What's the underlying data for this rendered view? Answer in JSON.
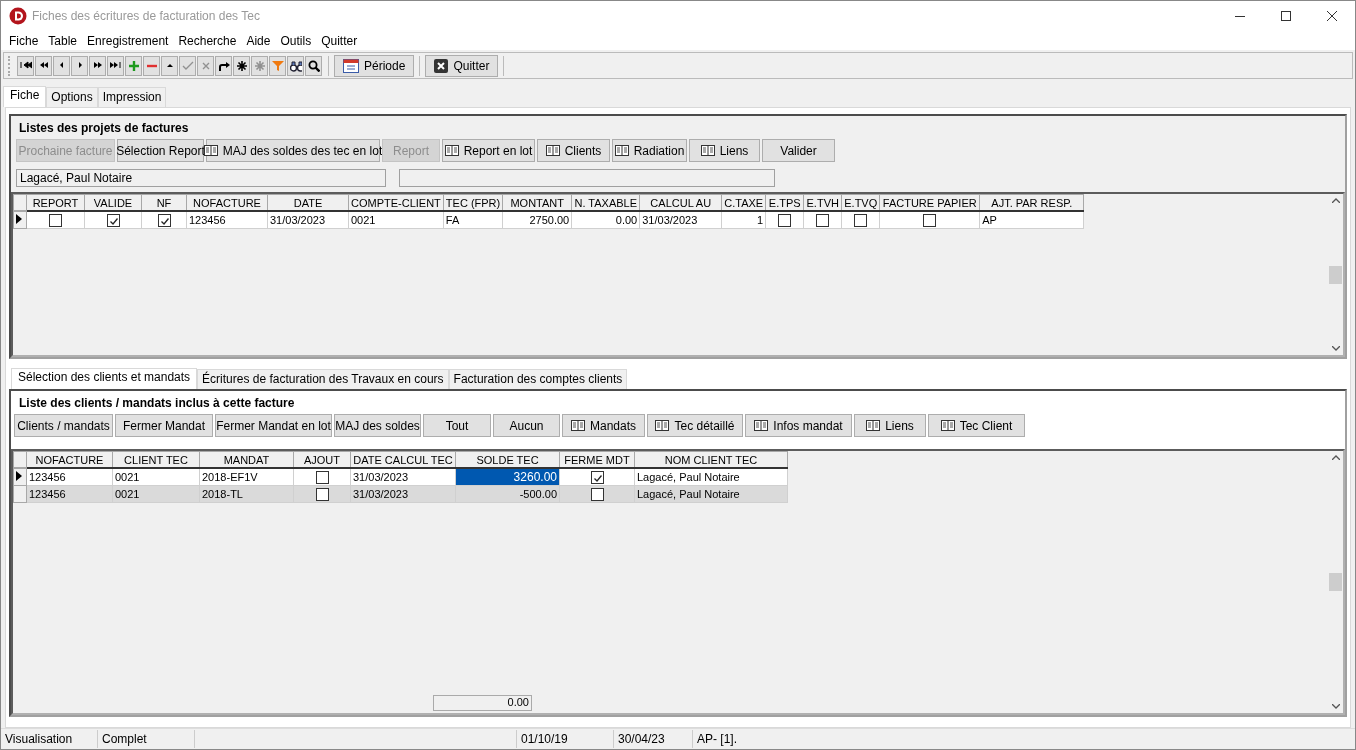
{
  "window": {
    "title": "Fiches des écritures de facturation des Tec"
  },
  "menu": [
    "Fiche",
    "Table",
    "Enregistrement",
    "Recherche",
    "Aide",
    "Outils",
    "Quitter"
  ],
  "toolbar": {
    "icons": [
      {
        "kind": "first",
        "disabled": false
      },
      {
        "kind": "prev-page",
        "disabled": false
      },
      {
        "kind": "prev",
        "disabled": false
      },
      {
        "kind": "next",
        "disabled": false
      },
      {
        "kind": "next-page",
        "disabled": false
      },
      {
        "kind": "last",
        "disabled": false
      },
      {
        "kind": "add",
        "disabled": false
      },
      {
        "kind": "delete",
        "disabled": false
      },
      {
        "kind": "up",
        "disabled": false
      },
      {
        "kind": "confirm",
        "disabled": true
      },
      {
        "kind": "cancel",
        "disabled": true
      },
      {
        "kind": "redo",
        "disabled": false
      },
      {
        "kind": "star",
        "disabled": false
      },
      {
        "kind": "star",
        "disabled": true
      },
      {
        "kind": "filter",
        "disabled": false
      },
      {
        "kind": "binoculars",
        "disabled": false
      },
      {
        "kind": "search",
        "disabled": false
      }
    ],
    "buttons": [
      "Période",
      "Quitter"
    ]
  },
  "tabs": [
    {
      "label": "Fiche",
      "selected": true
    },
    {
      "label": "Options",
      "selected": false
    },
    {
      "label": "Impression",
      "selected": false
    }
  ],
  "projects": {
    "title": "Listes des projets de factures",
    "buttons": [
      {
        "label": "Prochaine facture",
        "icon": false,
        "disabled": true
      },
      {
        "label": "Sélection Report",
        "icon": false,
        "disabled": false
      },
      {
        "label": "MAJ des soldes des tec en lot",
        "icon": true,
        "disabled": false
      },
      {
        "label": "Report",
        "icon": false,
        "disabled": true
      },
      {
        "label": "Report en lot",
        "icon": true,
        "disabled": false
      },
      {
        "label": "Clients",
        "icon": true,
        "disabled": false
      },
      {
        "label": "Radiation",
        "icon": true,
        "disabled": false
      },
      {
        "label": "Liens",
        "icon": true,
        "disabled": false
      },
      {
        "label": "Valider",
        "icon": false,
        "disabled": false
      }
    ],
    "fields": [
      "Lagacé, Paul Notaire"
    ],
    "table": {
      "columns": [
        {
          "label": "REPORT",
          "kind": "check"
        },
        {
          "label": "VALIDE",
          "kind": "check"
        },
        {
          "label": "NF",
          "kind": "check"
        },
        {
          "label": "NOFACTURE",
          "kind": "text"
        },
        {
          "label": "DATE",
          "kind": "text"
        },
        {
          "label": "COMPTE-CLIENT",
          "kind": "text"
        },
        {
          "label": "TEC (FPR)",
          "kind": "text"
        },
        {
          "label": "MONTANT",
          "kind": "number"
        },
        {
          "label": "N. TAXABLE",
          "kind": "number"
        },
        {
          "label": "CALCUL AU",
          "kind": "text"
        },
        {
          "label": "C.TAXE",
          "kind": "number"
        },
        {
          "label": "E.TPS",
          "kind": "check"
        },
        {
          "label": "E.TVH",
          "kind": "check"
        },
        {
          "label": "E.TVQ",
          "kind": "check"
        },
        {
          "label": "FACTURE PAPIER",
          "kind": "check"
        },
        {
          "label": "AJT. PAR RESP.",
          "kind": "text"
        }
      ],
      "rows": [
        {
          "selected": true,
          "cells": [
            {
              "checked": false
            },
            {
              "checked": true
            },
            {
              "checked": true
            },
            {
              "text": "123456"
            },
            {
              "text": "31/03/2023"
            },
            {
              "text": "0021"
            },
            {
              "text": "FA"
            },
            {
              "text": "2750.00"
            },
            {
              "text": "0.00"
            },
            {
              "text": "31/03/2023"
            },
            {
              "text": "1"
            },
            {
              "checked": false
            },
            {
              "checked": false
            },
            {
              "checked": false
            },
            {
              "checked": false
            },
            {
              "text": "AP"
            }
          ]
        }
      ]
    }
  },
  "lower_tabs": [
    {
      "label": "Sélection des clients et mandats",
      "selected": true
    },
    {
      "label": "Écritures de facturation des Travaux en cours",
      "selected": false
    },
    {
      "label": "Facturation des comptes clients",
      "selected": false
    }
  ],
  "clients": {
    "title": "Liste des clients / mandats inclus à cette facture",
    "buttons": [
      {
        "label": "Clients / mandats",
        "icon": false,
        "disabled": false
      },
      {
        "label": "Fermer Mandat",
        "icon": false,
        "disabled": false
      },
      {
        "label": "Fermer Mandat en lot",
        "icon": false,
        "disabled": false
      },
      {
        "label": "MAJ des soldes",
        "icon": false,
        "disabled": false
      },
      {
        "label": "Tout",
        "icon": false,
        "disabled": false
      },
      {
        "label": "Aucun",
        "icon": false,
        "disabled": false
      },
      {
        "label": "Mandats",
        "icon": true,
        "disabled": false
      },
      {
        "label": "Tec détaillé",
        "icon": true,
        "disabled": false
      },
      {
        "label": "Infos mandat",
        "icon": true,
        "disabled": false
      },
      {
        "label": "Liens",
        "icon": true,
        "disabled": false
      },
      {
        "label": "Tec Client",
        "icon": true,
        "disabled": false
      }
    ],
    "table": {
      "columns": [
        {
          "label": "NOFACTURE",
          "kind": "text"
        },
        {
          "label": "CLIENT TEC",
          "kind": "text"
        },
        {
          "label": "MANDAT",
          "kind": "text"
        },
        {
          "label": "AJOUT",
          "kind": "check"
        },
        {
          "label": "DATE CALCUL TEC",
          "kind": "text"
        },
        {
          "label": "SOLDE TEC",
          "kind": "number"
        },
        {
          "label": "FERME MDT",
          "kind": "check"
        },
        {
          "label": "NOM CLIENT TEC",
          "kind": "text"
        }
      ],
      "rows": [
        {
          "selected": true,
          "cells": [
            {
              "text": "123456"
            },
            {
              "text": "0021"
            },
            {
              "text": "2018-EF1V"
            },
            {
              "checked": false
            },
            {
              "text": "31/03/2023"
            },
            {
              "text": "3260.00",
              "focused": true
            },
            {
              "checked": true
            },
            {
              "text": "Lagacé, Paul Notaire"
            }
          ]
        },
        {
          "selected": false,
          "cells": [
            {
              "text": "123456"
            },
            {
              "text": "0021"
            },
            {
              "text": "2018-TL"
            },
            {
              "checked": false
            },
            {
              "text": "31/03/2023"
            },
            {
              "text": "-500.00"
            },
            {
              "checked": false
            },
            {
              "text": "Lagacé, Paul Notaire"
            }
          ]
        }
      ]
    },
    "total": "0.00"
  },
  "status_bar": [
    "Visualisation",
    "Complet",
    "01/10/19",
    "30/04/23",
    "AP- [1]."
  ]
}
